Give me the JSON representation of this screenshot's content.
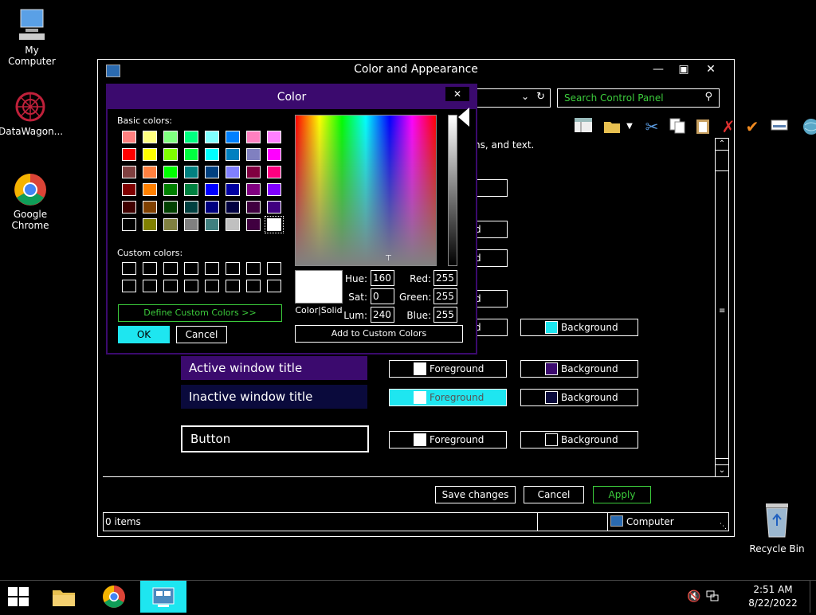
{
  "desktop": {
    "icons": [
      {
        "label": "My Computer"
      },
      {
        "label": "DataWagon..."
      },
      {
        "label": "Google Chrome"
      },
      {
        "label": "Recycle Bin"
      }
    ]
  },
  "main_window": {
    "title": "Color and Appearance",
    "search_placeholder": "Search Control Panel",
    "description_fragment": "ns, and text.",
    "rows": [
      {
        "label": "Active window title",
        "fg": "Foreground",
        "bg": "Background"
      },
      {
        "label": "Inactive window title",
        "fg": "Foreground",
        "bg": "Background"
      },
      {
        "label": "Button",
        "fg": "Foreground",
        "bg": "Background"
      }
    ],
    "partial_rows": {
      "bg_label": "Background",
      "fg_partial": "d"
    },
    "buttons": {
      "save": "Save changes",
      "cancel": "Cancel",
      "apply": "Apply"
    },
    "status": {
      "items": "0 items",
      "location": "Computer"
    }
  },
  "color_dialog": {
    "title": "Color",
    "basic_colors_label": "Basic colors:",
    "custom_colors_label": "Custom colors:",
    "define_custom": "Define Custom Colors >>",
    "ok": "OK",
    "cancel": "Cancel",
    "color_solid": "Color|Solid",
    "add_custom": "Add to Custom Colors",
    "fields": {
      "hue_label": "Hue:",
      "hue": "160",
      "sat_label": "Sat:",
      "sat": "0",
      "lum_label": "Lum:",
      "lum": "240",
      "red_label": "Red:",
      "red": "255",
      "green_label": "Green:",
      "green": "255",
      "blue_label": "Blue:",
      "blue": "255"
    },
    "basic_colors": [
      "#ff8080",
      "#ffff80",
      "#80ff80",
      "#00ff80",
      "#80ffff",
      "#0080ff",
      "#ff80c0",
      "#ff80ff",
      "#ff0000",
      "#ffff00",
      "#80ff00",
      "#00ff40",
      "#00ffff",
      "#0080c0",
      "#8080c0",
      "#ff00ff",
      "#804040",
      "#ff8040",
      "#00ff00",
      "#008080",
      "#004080",
      "#8080ff",
      "#800040",
      "#ff0080",
      "#800000",
      "#ff8000",
      "#008000",
      "#008040",
      "#0000ff",
      "#0000a0",
      "#800080",
      "#8000ff",
      "#400000",
      "#804000",
      "#004000",
      "#004040",
      "#000080",
      "#000040",
      "#400040",
      "#400080",
      "#000000",
      "#808000",
      "#808040",
      "#808080",
      "#408080",
      "#c0c0c0",
      "#400040",
      "#ffffff"
    ]
  },
  "taskbar": {
    "time": "2:51 AM",
    "date": "8/22/2022"
  },
  "colors": {
    "accent_purple": "#3b0a6e",
    "cyan": "#1ee6f0",
    "green_text": "#3ccc3c",
    "inactive_bg": "#0a0a3c"
  }
}
